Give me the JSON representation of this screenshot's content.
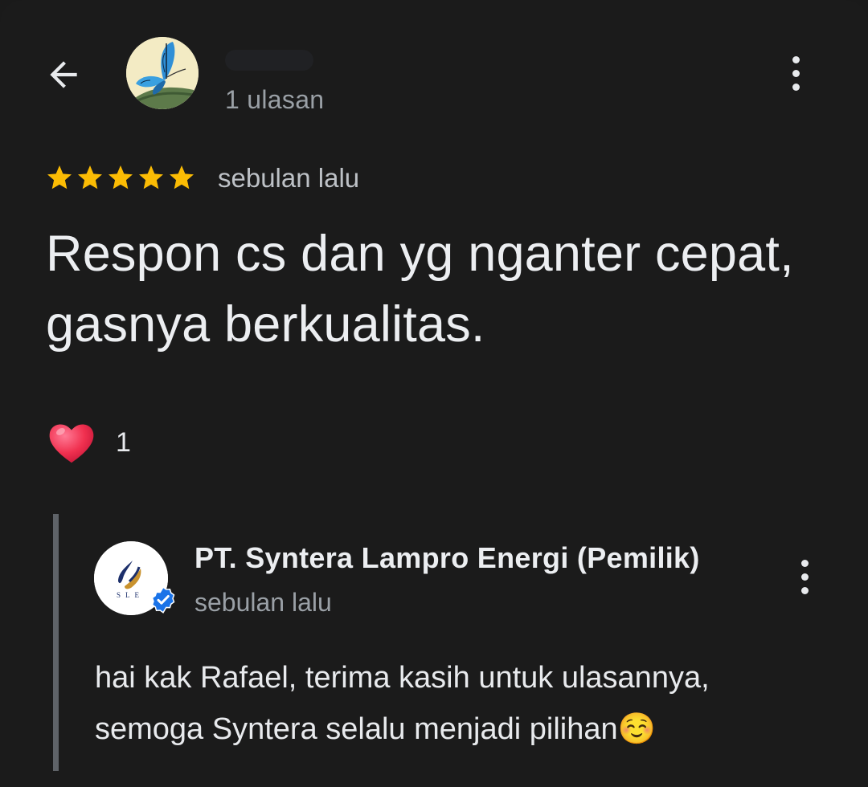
{
  "header": {
    "back_icon": "arrow-left-icon",
    "reviewer_avatar": "butterfly-avatar",
    "review_count": "1 ulasan",
    "menu_icon": "more-vertical-icon"
  },
  "review": {
    "rating": 5,
    "rating_max": 5,
    "star_color": "#fbbc04",
    "time": "sebulan lalu",
    "text": "Respon cs dan yg nganter cepat, gasnya berkualitas."
  },
  "reaction": {
    "icon": "heart-icon",
    "count": "1"
  },
  "owner_reply": {
    "name": "PT. Syntera Lampro Energi (Pemilik)",
    "logo_icon": "sle-logo",
    "verified_icon": "verified-badge-icon",
    "time": "sebulan lalu",
    "text_lines": [
      "hai kak Rafael, terima kasih untuk ulasannya,",
      "semoga Syntera selalu menjadi pilihan☺️"
    ],
    "menu_icon": "more-vertical-icon"
  }
}
